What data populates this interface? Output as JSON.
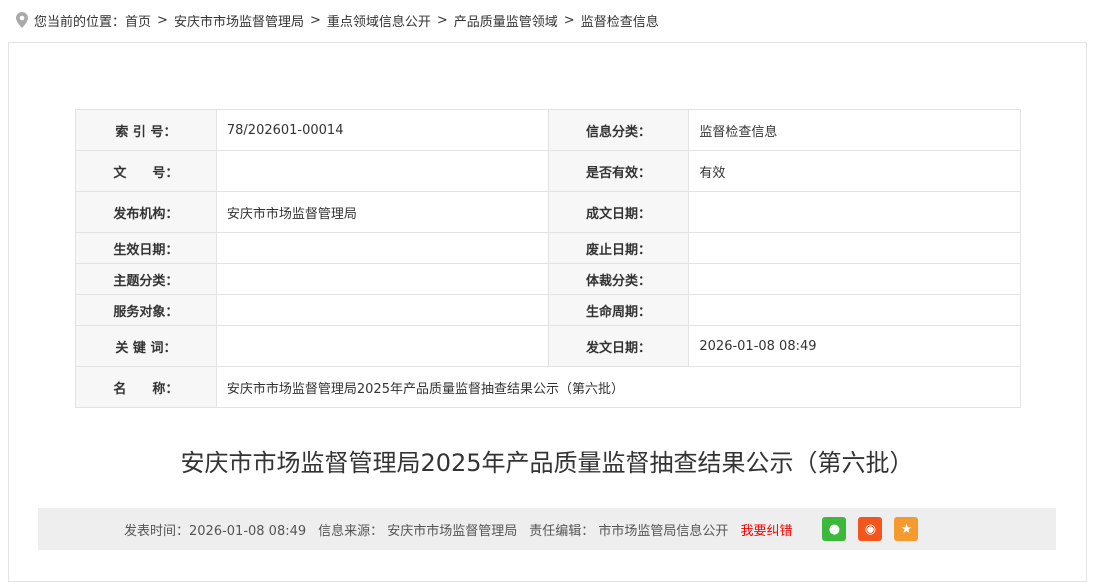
{
  "breadcrumb": {
    "prefix": "您当前的位置：",
    "items": [
      "首页",
      "安庆市市场监督管理局",
      "重点领域信息公开",
      "产品质量监管领域",
      "监督检查信息"
    ],
    "separator": ">"
  },
  "meta": [
    {
      "k1": "索 引 号：",
      "v1": "78/202601-00014",
      "k2": "信息分类：",
      "v2": "监督检查信息",
      "h": 41
    },
    {
      "k1": "文　　号：",
      "v1": "",
      "k2": "是否有效：",
      "v2": "有效",
      "h": 41
    },
    {
      "k1": "发布机构：",
      "v1": "安庆市市场监督管理局",
      "k2": "成文日期：",
      "v2": "",
      "h": 41
    },
    {
      "k1": "生效日期：",
      "v1": "",
      "k2": "废止日期：",
      "v2": "",
      "h": 31
    },
    {
      "k1": "主题分类：",
      "v1": "",
      "k2": "体裁分类：",
      "v2": "",
      "h": 31
    },
    {
      "k1": "服务对象：",
      "v1": "",
      "k2": "生命周期：",
      "v2": "",
      "h": 31
    },
    {
      "k1": "关 键 词：",
      "v1": "",
      "k2": "发文日期：",
      "v2": "2026-01-08 08:49",
      "h": 41
    }
  ],
  "name_row": {
    "k": "名　　称：",
    "v": "安庆市市场监督管理局2025年产品质量监督抽查结果公示（第六批）"
  },
  "title": "安庆市市场监督管理局2025年产品质量监督抽查结果公示（第六批）",
  "info": {
    "time": "发表时间：2026-01-08 08:49",
    "source": "信息来源： 安庆市市场监督管理局",
    "editor": "责任编辑： 市市场监管局信息公开",
    "error": "我要纠错"
  },
  "colors": {
    "wechat": "#3cb83c",
    "weibo": "#f2561d",
    "fav": "#f59a2f",
    "error": "#ff0000"
  }
}
